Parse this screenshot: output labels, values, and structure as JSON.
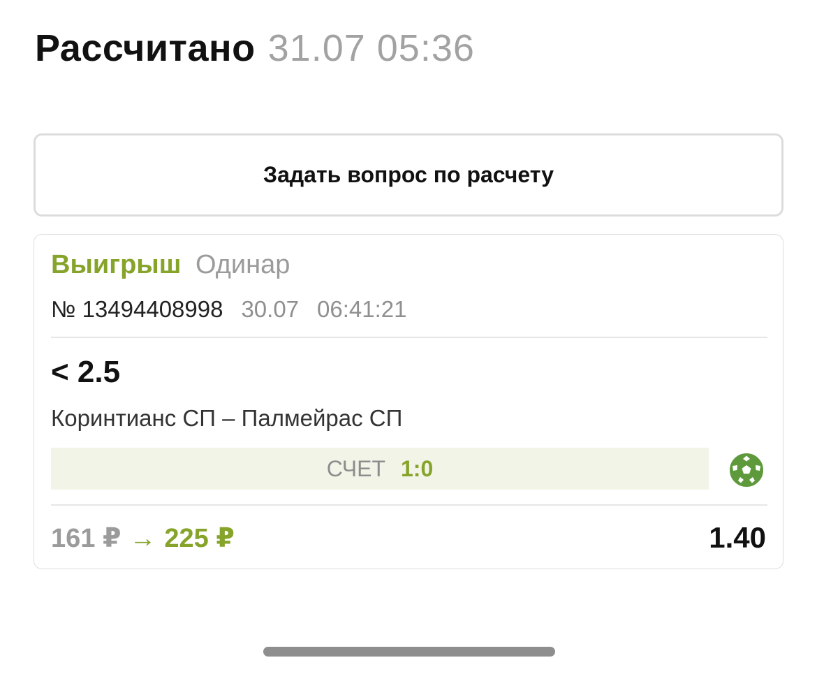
{
  "header": {
    "title": "Рассчитано",
    "datetime": "31.07 05:36"
  },
  "ask_button": {
    "label": "Задать вопрос по расчету"
  },
  "bet": {
    "status": "Выигрыш",
    "type": "Одинар",
    "number": "№ 13494408998",
    "date": "30.07",
    "time": "06:41:21",
    "outcome": "< 2.5",
    "event": "Коринтианс СП – Палмейрас СП",
    "score_label": "СЧЕТ",
    "score_value": "1:0",
    "sport_icon": "soccer-ball-icon",
    "stake": "161 ₽",
    "arrow": "→",
    "payout": "225 ₽",
    "odds": "1.40"
  },
  "colors": {
    "accent_green": "#86a32a",
    "icon_green": "#5e9a3c",
    "score_bg": "#f2f4e8",
    "muted_text": "#9b9b9b"
  }
}
